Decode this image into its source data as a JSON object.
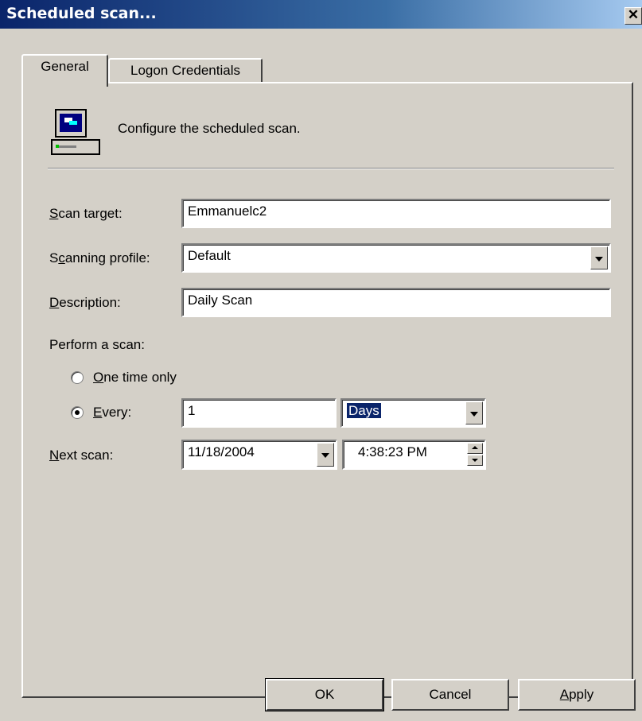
{
  "window": {
    "title": "Scheduled scan...",
    "close_glyph": "✕"
  },
  "tabs": [
    {
      "label": "General",
      "active": true
    },
    {
      "label": "Logon Credentials",
      "active": false
    }
  ],
  "header": {
    "icon": "computer-icon",
    "text": "Configure the scheduled scan."
  },
  "form": {
    "scan_target": {
      "label_mnemonic": "S",
      "label_rest": "can target:",
      "value": "Emmanuelc2"
    },
    "scanning_profile": {
      "label_pre": "S",
      "label_mnemonic": "c",
      "label_rest": "anning profile:",
      "value": "Default"
    },
    "description": {
      "label_mnemonic": "D",
      "label_rest": "escription:",
      "value": "Daily Scan"
    },
    "perform_label": "Perform a scan:",
    "one_time": {
      "label_mnemonic": "O",
      "label_rest": "ne time only",
      "checked": false
    },
    "every": {
      "label_mnemonic": "E",
      "label_rest": "very:",
      "checked": true,
      "value": "1",
      "unit": "Days"
    },
    "next_scan": {
      "label_mnemonic": "N",
      "label_rest": "ext scan:",
      "date": "11/18/2004",
      "time": "4:38:23 PM"
    }
  },
  "buttons": {
    "ok": "OK",
    "cancel": "Cancel",
    "apply_mnemonic": "A",
    "apply_rest": "pply"
  },
  "colors": {
    "titlebar": "#0a246a",
    "face": "#d4d0c8",
    "selection": "#0a246a"
  }
}
